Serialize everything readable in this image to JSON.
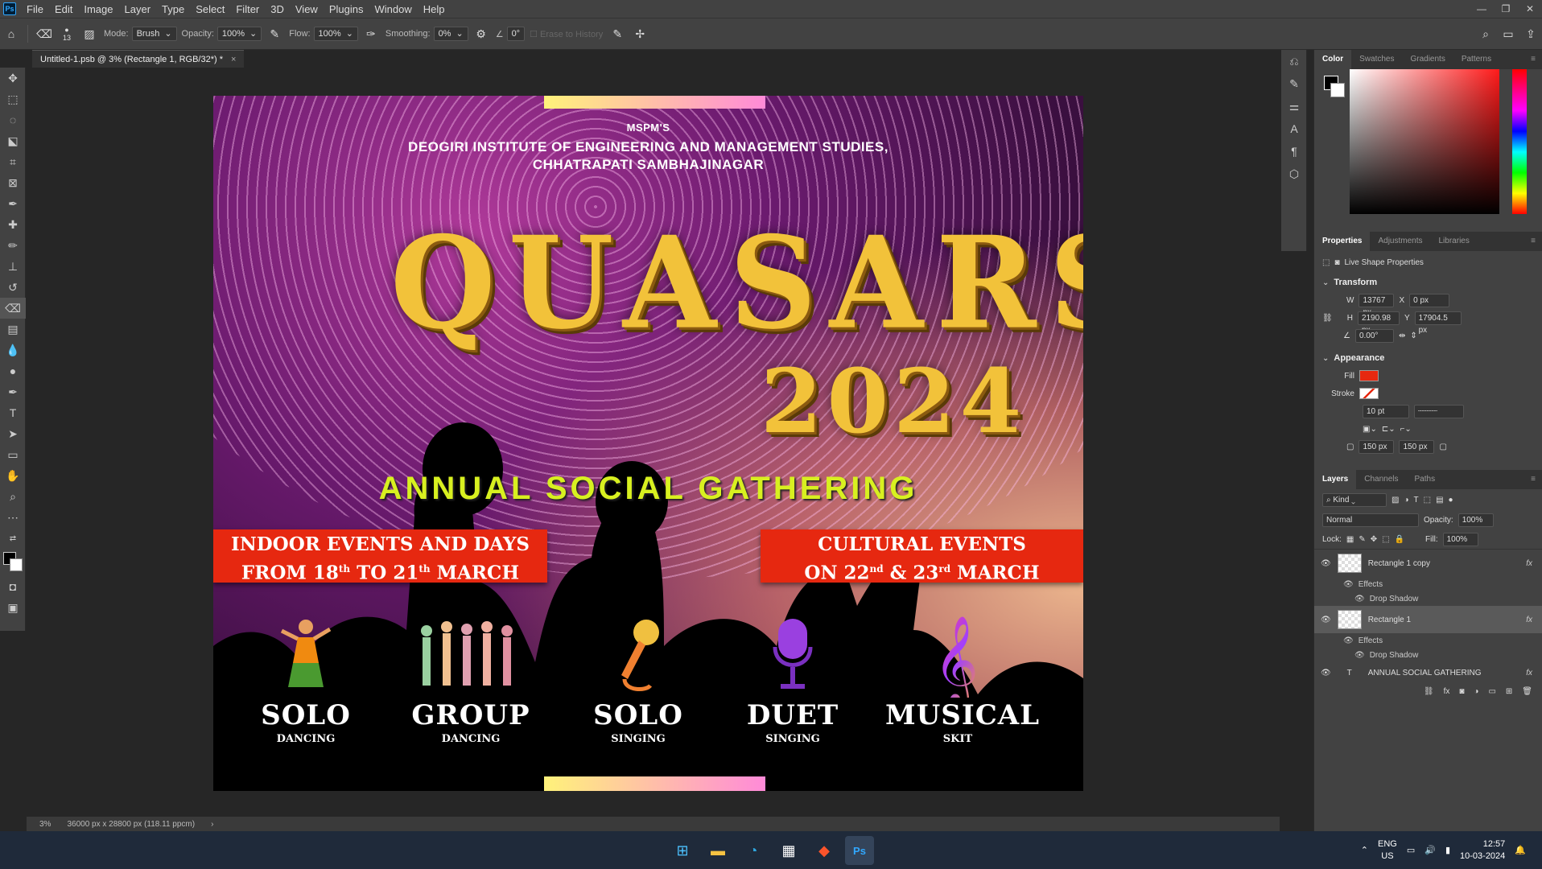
{
  "app": {
    "logo": "Ps"
  },
  "menu": [
    "File",
    "Edit",
    "Image",
    "Layer",
    "Type",
    "Select",
    "Filter",
    "3D",
    "View",
    "Plugins",
    "Window",
    "Help"
  ],
  "window_controls": {
    "minimize": "—",
    "restore": "❐",
    "close": "✕"
  },
  "options": {
    "brush_size": "13",
    "mode_label": "Mode:",
    "mode_value": "Brush",
    "opacity_label": "Opacity:",
    "opacity_value": "100%",
    "flow_label": "Flow:",
    "flow_value": "100%",
    "smoothing_label": "Smoothing:",
    "smoothing_value": "0%",
    "angle_value": "0°",
    "erase_history": "Erase to History"
  },
  "document": {
    "tab_title": "Untitled-1.psb @ 3% (Rectangle 1, RGB/32*) *",
    "close": "×"
  },
  "status": {
    "zoom": "3%",
    "dimensions": "36000 px x 28800 px (118.11 ppcm)",
    "arrow": "›"
  },
  "poster": {
    "org": "MSPM'S",
    "institute": "DEOGIRI INSTITUTE OF ENGINEERING AND MANAGEMENT STUDIES,",
    "city": "CHHATRAPATI SAMBHAJINAGAR",
    "title": "QUASARS",
    "year": "2024",
    "tagline": "ANNUAL SOCIAL GATHERING",
    "box_left_line1": "INDOOR EVENTS AND DAYS",
    "box_left_line2_a": "FROM 18",
    "box_left_sup1": "th",
    "box_left_line2_b": " TO 21",
    "box_left_sup2": "th",
    "box_left_line2_c": " MARCH",
    "box_right_line1": "CULTURAL EVENTS",
    "box_right_line2_a": "ON 22",
    "box_right_sup1": "nd",
    "box_right_line2_b": " & 23",
    "box_right_sup2": "rd",
    "box_right_line2_c": " MARCH",
    "events": [
      {
        "name": "SOLO",
        "sub": "DANCING"
      },
      {
        "name": "GROUP",
        "sub": "DANCING"
      },
      {
        "name": "SOLO",
        "sub": "SINGING"
      },
      {
        "name": "DUET",
        "sub": "SINGING"
      },
      {
        "name": "MUSICAL",
        "sub": "SKIT"
      }
    ]
  },
  "color_panel": {
    "tabs": [
      "Color",
      "Swatches",
      "Gradients",
      "Patterns"
    ]
  },
  "properties_panel": {
    "tabs": [
      "Properties",
      "Adjustments",
      "Libraries"
    ],
    "live_shape": "Live Shape Properties",
    "transform": "Transform",
    "w_label": "W",
    "w_value": "13767 px",
    "x_label": "X",
    "x_value": "0 px",
    "h_label": "H",
    "h_value": "2190.98 px",
    "y_label": "Y",
    "y_value": "17904.5 px",
    "angle_value": "0.00°",
    "appearance": "Appearance",
    "fill_label": "Fill",
    "fill_color": "#e62810",
    "stroke_label": "Stroke",
    "stroke_width": "10 pt",
    "radius1": "150 px",
    "radius2": "150 px"
  },
  "layers_panel": {
    "tabs": [
      "Layers",
      "Channels",
      "Paths"
    ],
    "kind": "Kind",
    "blend": "Normal",
    "opacity_label": "Opacity:",
    "opacity_value": "100%",
    "lock_label": "Lock:",
    "fill_label": "Fill:",
    "fill_value": "100%",
    "layers": [
      {
        "name": "Rectangle 1 copy",
        "effects": "Effects",
        "effect": "Drop Shadow",
        "fx": "fx"
      },
      {
        "name": "Rectangle 1",
        "effects": "Effects",
        "effect": "Drop Shadow",
        "fx": "fx"
      },
      {
        "name": "ANNUAL SOCIAL GATHERING",
        "fx": "fx"
      }
    ]
  },
  "taskbar": {
    "lang1": "ENG",
    "lang2": "US",
    "time": "12:57",
    "date": "10-03-2024"
  }
}
